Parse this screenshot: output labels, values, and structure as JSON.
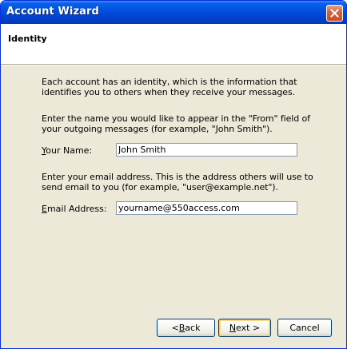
{
  "window": {
    "title": "Account Wizard"
  },
  "header": {
    "page_title": "Identity"
  },
  "body": {
    "intro_text": "Each account has an identity, which is the information that identifies you to others when they receive your messages.",
    "name_prompt": "Enter the name you would like to appear in the \"From\" field of your outgoing messages (for example, \"John Smith\").",
    "email_prompt": "Enter your email address. This is the address others will use to send email to you (for example, \"user@example.net\")."
  },
  "fields": {
    "name": {
      "label_access": "Y",
      "label_rest": "our Name:",
      "value": "John Smith"
    },
    "email": {
      "label_access": "E",
      "label_rest": "mail Address:",
      "value": "yourname@550access.com"
    }
  },
  "buttons": {
    "back_prefix": "< ",
    "back_access": "B",
    "back_rest": "ack",
    "next_access": "N",
    "next_rest": "ext >",
    "cancel": "Cancel"
  },
  "icons": {
    "close": "close-icon"
  },
  "colors": {
    "titlebar": "#0054e3",
    "window_bg": "#ece9d8",
    "input_border": "#7f9db9",
    "close_button": "#d9623e"
  }
}
